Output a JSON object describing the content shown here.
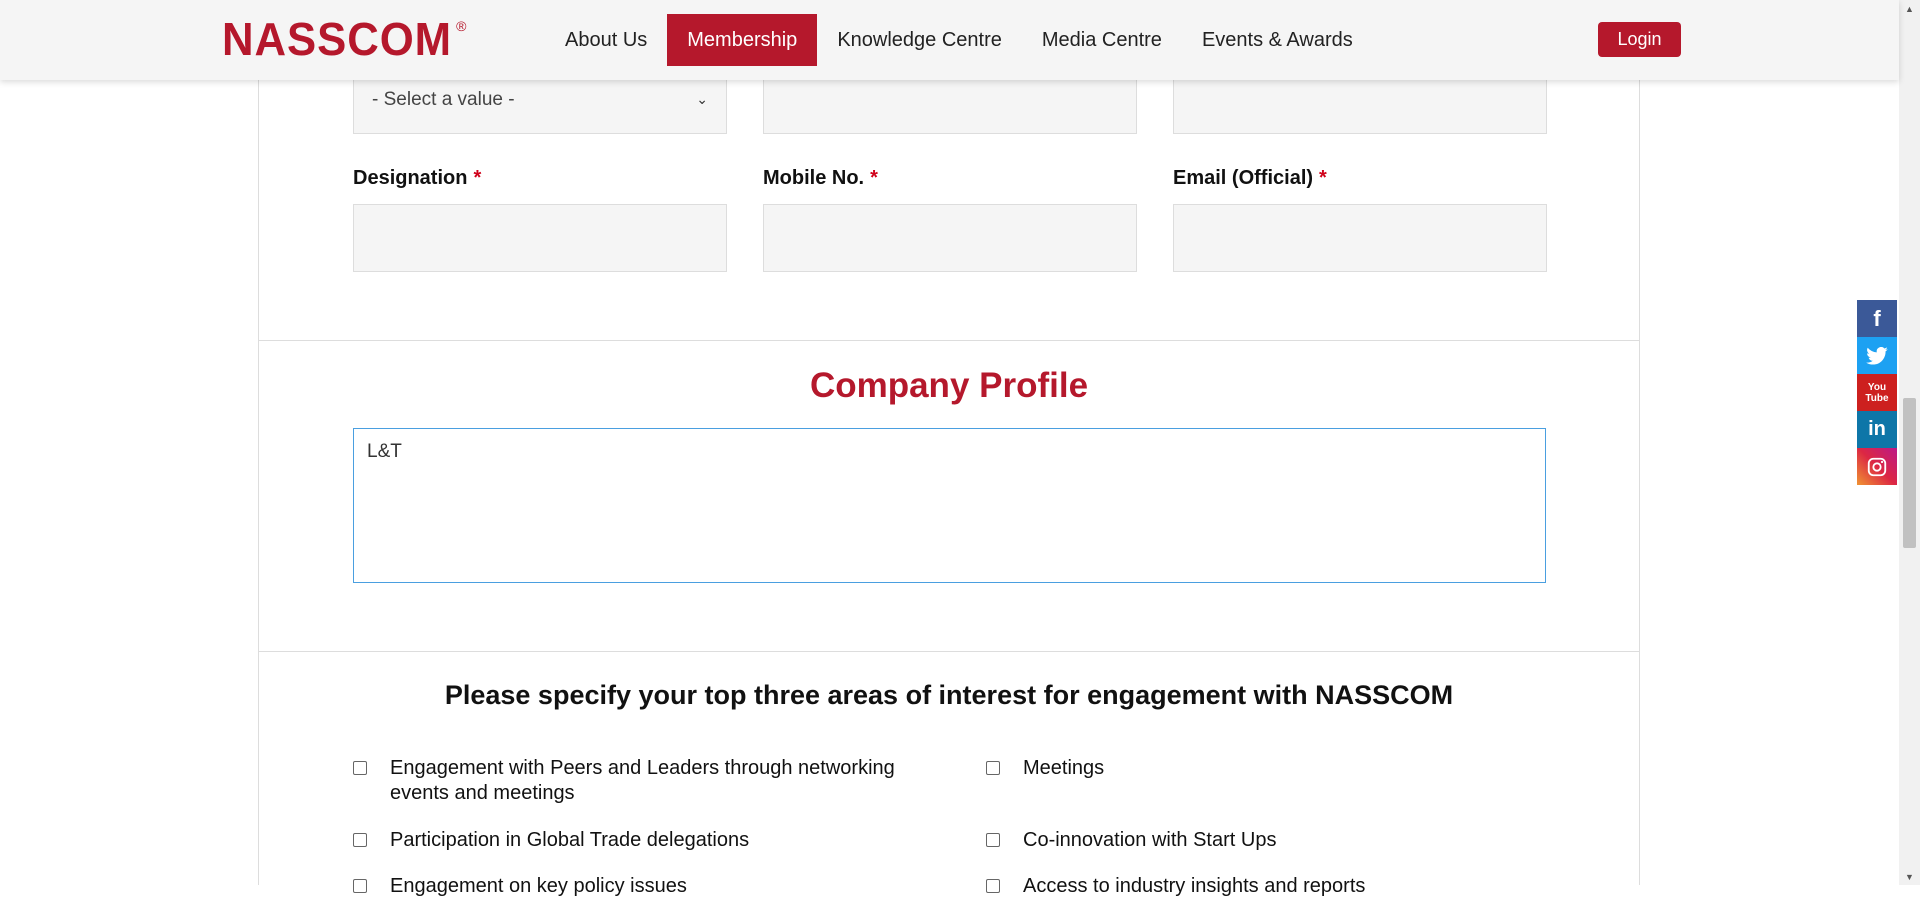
{
  "header": {
    "logo_text": "NASSCOM",
    "logo_reg": "®",
    "nav": [
      {
        "label": "About Us"
      },
      {
        "label": "Membership"
      },
      {
        "label": "Knowledge Centre"
      },
      {
        "label": "Media Centre"
      },
      {
        "label": "Events & Awards"
      }
    ],
    "login_label": "Login"
  },
  "form": {
    "select_value": "- Select a value -",
    "labels": {
      "designation": "Designation",
      "mobile": "Mobile No.",
      "email": "Email (Official)",
      "required_mark": "*"
    }
  },
  "company_profile": {
    "title": "Company Profile",
    "value": "L&T"
  },
  "interests": {
    "title": "Please specify your top three areas of interest for engagement with NASSCOM",
    "options": [
      {
        "label": "Engagement with Peers and Leaders through networking events and meetings"
      },
      {
        "label": "Meetings"
      },
      {
        "label": "Participation in Global Trade delegations"
      },
      {
        "label": "Co-innovation with Start Ups"
      },
      {
        "label": "Engagement on key policy issues"
      },
      {
        "label": "Access to industry insights and reports"
      }
    ]
  },
  "social": [
    "facebook-icon",
    "twitter-icon",
    "youtube-icon",
    "linkedin-icon",
    "instagram-icon"
  ],
  "colors": {
    "brand": "#b5182c",
    "required": "#d0021b",
    "focus_border": "#4a9fe0"
  }
}
